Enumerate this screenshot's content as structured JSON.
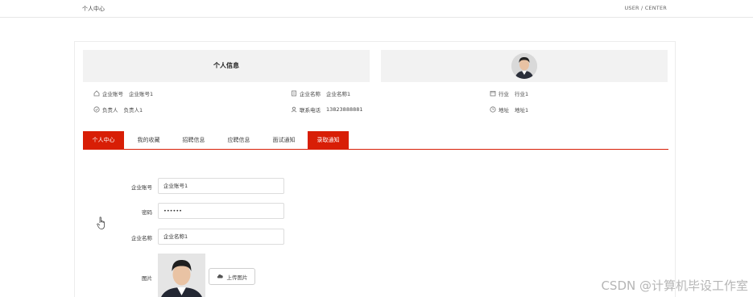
{
  "topbar": {
    "title": "个人中心",
    "right_text": "USER / CENTER"
  },
  "info": {
    "title": "个人信息",
    "account_label": "企业账号",
    "account_value": "企业账号1",
    "company_label": "企业名称",
    "company_value": "企业名称1",
    "industry_label": "行业",
    "industry_value": "行业1",
    "contact_label": "负责人",
    "contact_value": "负责人1",
    "phone_label": "联系电话",
    "phone_value": "13823888881",
    "address_label": "地址",
    "address_value": "地址1"
  },
  "tabs": [
    {
      "label": "个人中心",
      "active": true
    },
    {
      "label": "我的收藏"
    },
    {
      "label": "招聘信息"
    },
    {
      "label": "应聘信息"
    },
    {
      "label": "面试通知"
    },
    {
      "label": "录取通知",
      "active": true
    }
  ],
  "form": {
    "account_label": "企业账号",
    "account_value": "企业账号1",
    "password_label": "密码",
    "password_value": "••••••",
    "company_label": "企业名称",
    "company_value": "企业名称1",
    "image_label": "图片",
    "upload_label": "上传图片"
  },
  "watermark": "CSDN @计算机毕设工作室",
  "colors": {
    "accent": "#d81e06",
    "panel": "#f2f2f2"
  }
}
